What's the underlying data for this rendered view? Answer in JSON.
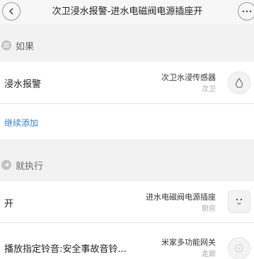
{
  "header": {
    "title": "次卫浸水报警-进水电磁阀电源插座开",
    "back_icon": "chevron-left-icon",
    "more_icon": "more-dots-icon"
  },
  "if_section": {
    "label": "如果",
    "icon": "list-icon",
    "condition": {
      "name": "浸水报警",
      "device": "次卫水浸传感器",
      "room": "次卫",
      "icon": "water-drop-icon"
    },
    "add_label": "继续添加"
  },
  "then_section": {
    "label": "就执行",
    "icon": "arrow-right-icon",
    "actions": [
      {
        "name": "开",
        "device": "进水电磁阀电源插座",
        "room": "厨房",
        "icon": "power-socket-icon"
      },
      {
        "name": "播放指定铃音:安全事故音铃...",
        "device": "米家多功能网关",
        "room": "走廊",
        "icon": "gateway-icon"
      }
    ]
  },
  "colors": {
    "background": "#f2f2f2",
    "card": "#ffffff",
    "link": "#3a7fc2",
    "muted": "#aaaaaa"
  }
}
